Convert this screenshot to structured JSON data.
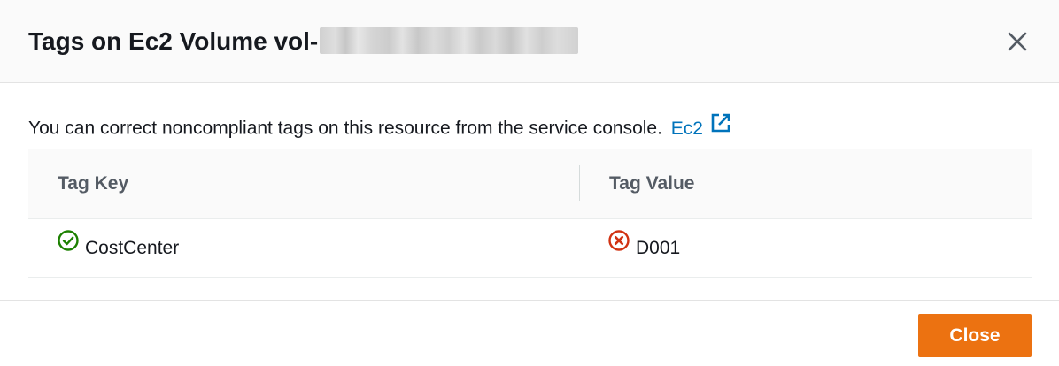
{
  "modal": {
    "title_prefix": "Tags on Ec2 Volume vol-",
    "close_icon": "close-icon"
  },
  "body": {
    "intro_text": "You can correct noncompliant tags on this resource from the service console.",
    "link_label": "Ec2",
    "link_icon": "external-link-icon",
    "link_color": "#0073bb"
  },
  "table": {
    "headers": [
      "Tag Key",
      "Tag Value"
    ],
    "rows": [
      {
        "key": "CostCenter",
        "key_status": "compliant",
        "key_icon": "check-circle-icon",
        "value": "D001",
        "value_status": "noncompliant",
        "value_icon": "error-circle-icon"
      }
    ]
  },
  "colors": {
    "success": "#1d8102",
    "error": "#d13212",
    "primary_button": "#ec7211"
  },
  "footer": {
    "close_label": "Close"
  }
}
